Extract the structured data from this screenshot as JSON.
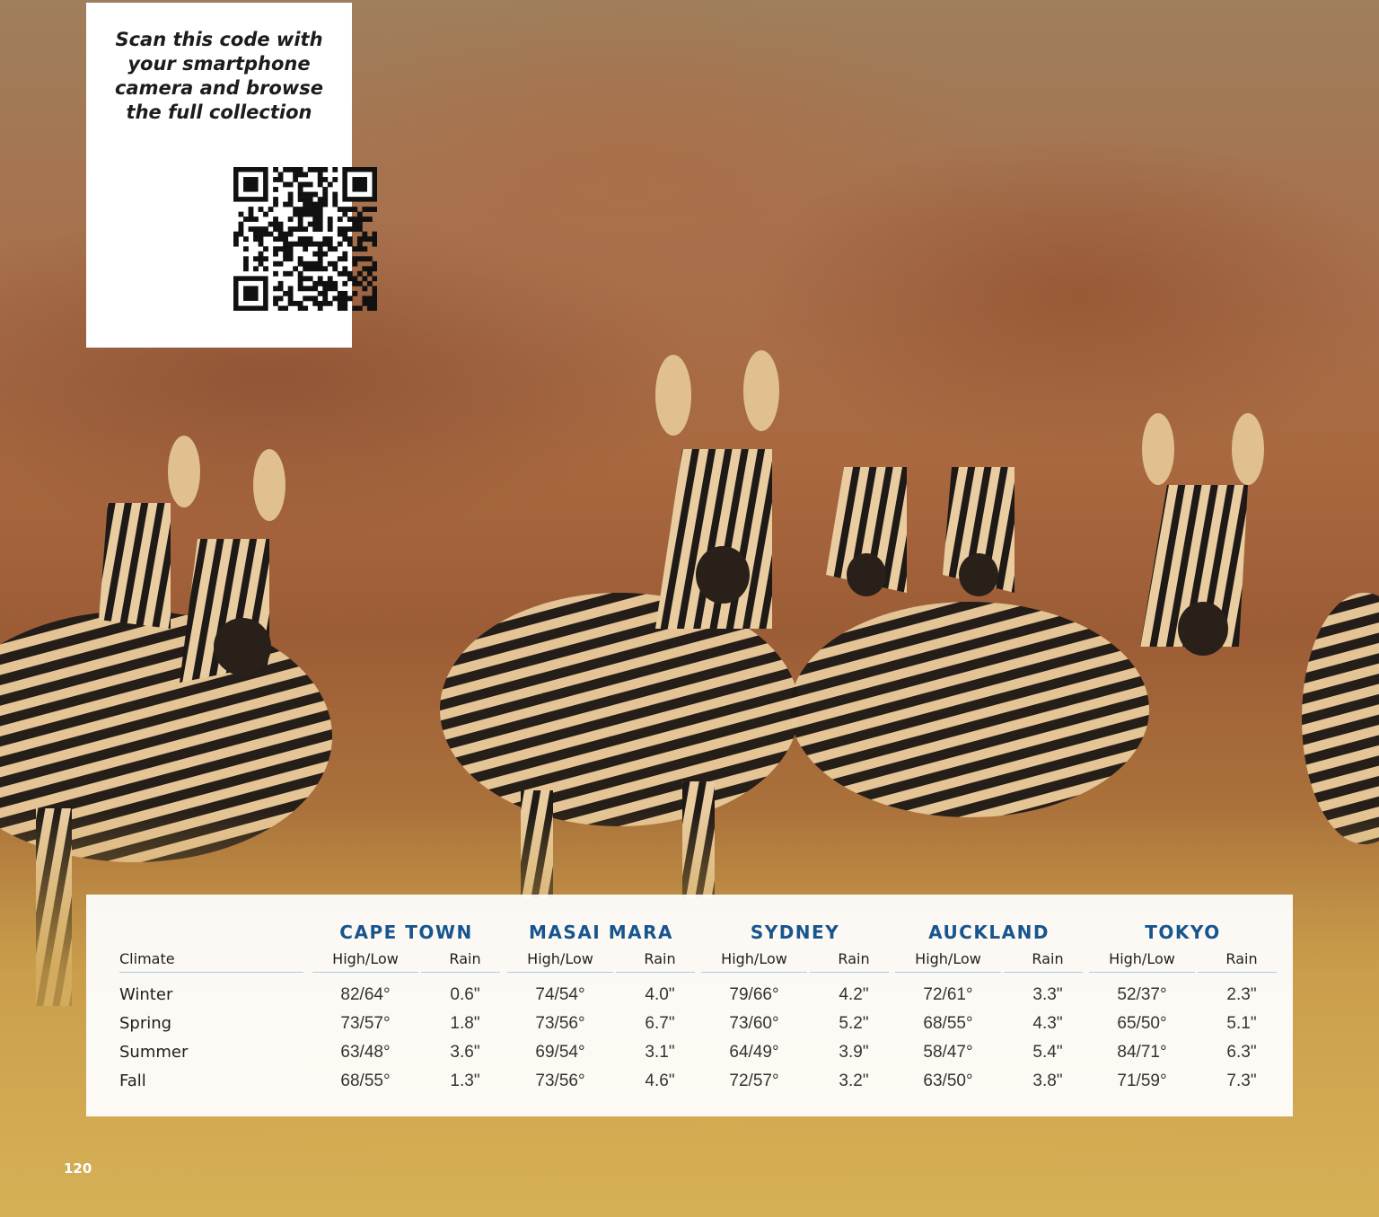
{
  "qr_panel": {
    "line1": "Scan this code with",
    "line2": "your smartphone",
    "line3": "camera and browse",
    "line4": "the full collection"
  },
  "climate_table": {
    "row_header": "Climate",
    "high_low_label": "High/Low",
    "rain_label": "Rain",
    "cities": [
      "CAPE TOWN",
      "MASAI MARA",
      "SYDNEY",
      "AUCKLAND",
      "TOKYO"
    ],
    "rows": [
      {
        "season": "Winter",
        "values": [
          "82/64°",
          "0.6\"",
          "74/54°",
          "4.0\"",
          "79/66°",
          "4.2\"",
          "72/61°",
          "3.3\"",
          "52/37°",
          "2.3\""
        ]
      },
      {
        "season": "Spring",
        "values": [
          "73/57°",
          "1.8\"",
          "73/56°",
          "6.7\"",
          "73/60°",
          "5.2\"",
          "68/55°",
          "4.3\"",
          "65/50°",
          "5.1\""
        ]
      },
      {
        "season": "Summer",
        "values": [
          "63/48°",
          "3.6\"",
          "69/54°",
          "3.1\"",
          "64/49°",
          "3.9\"",
          "58/47°",
          "5.4\"",
          "84/71°",
          "6.3\""
        ]
      },
      {
        "season": "Fall",
        "values": [
          "68/55°",
          "1.3\"",
          "73/56°",
          "4.6\"",
          "72/57°",
          "3.2\"",
          "63/50°",
          "3.8\"",
          "71/59°",
          "7.3\""
        ]
      }
    ]
  },
  "page_number": "120",
  "colors": {
    "city_heading": "#17558f",
    "rule": "#aacbe6"
  }
}
